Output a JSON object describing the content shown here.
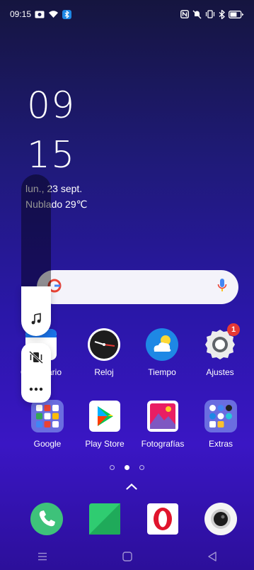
{
  "status_bar": {
    "time": "09:15"
  },
  "lockclock": {
    "hour": "09",
    "minute": "15",
    "date": "lun., 23 sept.",
    "weather": "Nublado 29℃"
  },
  "volume_panel": {
    "level_fraction": 0.3
  },
  "apps_row1": [
    {
      "label": "Calendario",
      "icon": "calendar-icon"
    },
    {
      "label": "Reloj",
      "icon": "clock-icon"
    },
    {
      "label": "Tiempo",
      "icon": "weather-icon"
    },
    {
      "label": "Ajustes",
      "icon": "settings-icon",
      "badge": "1"
    }
  ],
  "apps_row2": [
    {
      "label": "Google",
      "icon": "google-folder-icon"
    },
    {
      "label": "Play Store",
      "icon": "play-store-icon"
    },
    {
      "label": "Fotografías",
      "icon": "photos-icon"
    },
    {
      "label": "Extras",
      "icon": "extras-folder-icon"
    }
  ],
  "dock": [
    {
      "icon": "phone-icon"
    },
    {
      "icon": "messages-icon"
    },
    {
      "icon": "opera-icon"
    },
    {
      "icon": "camera-icon"
    }
  ],
  "page_indicator": {
    "count": 3,
    "active": 1
  },
  "colors": {
    "accent_blue": "#1e88e5",
    "badge_red": "#e53935",
    "opera_red": "#e0142c"
  }
}
